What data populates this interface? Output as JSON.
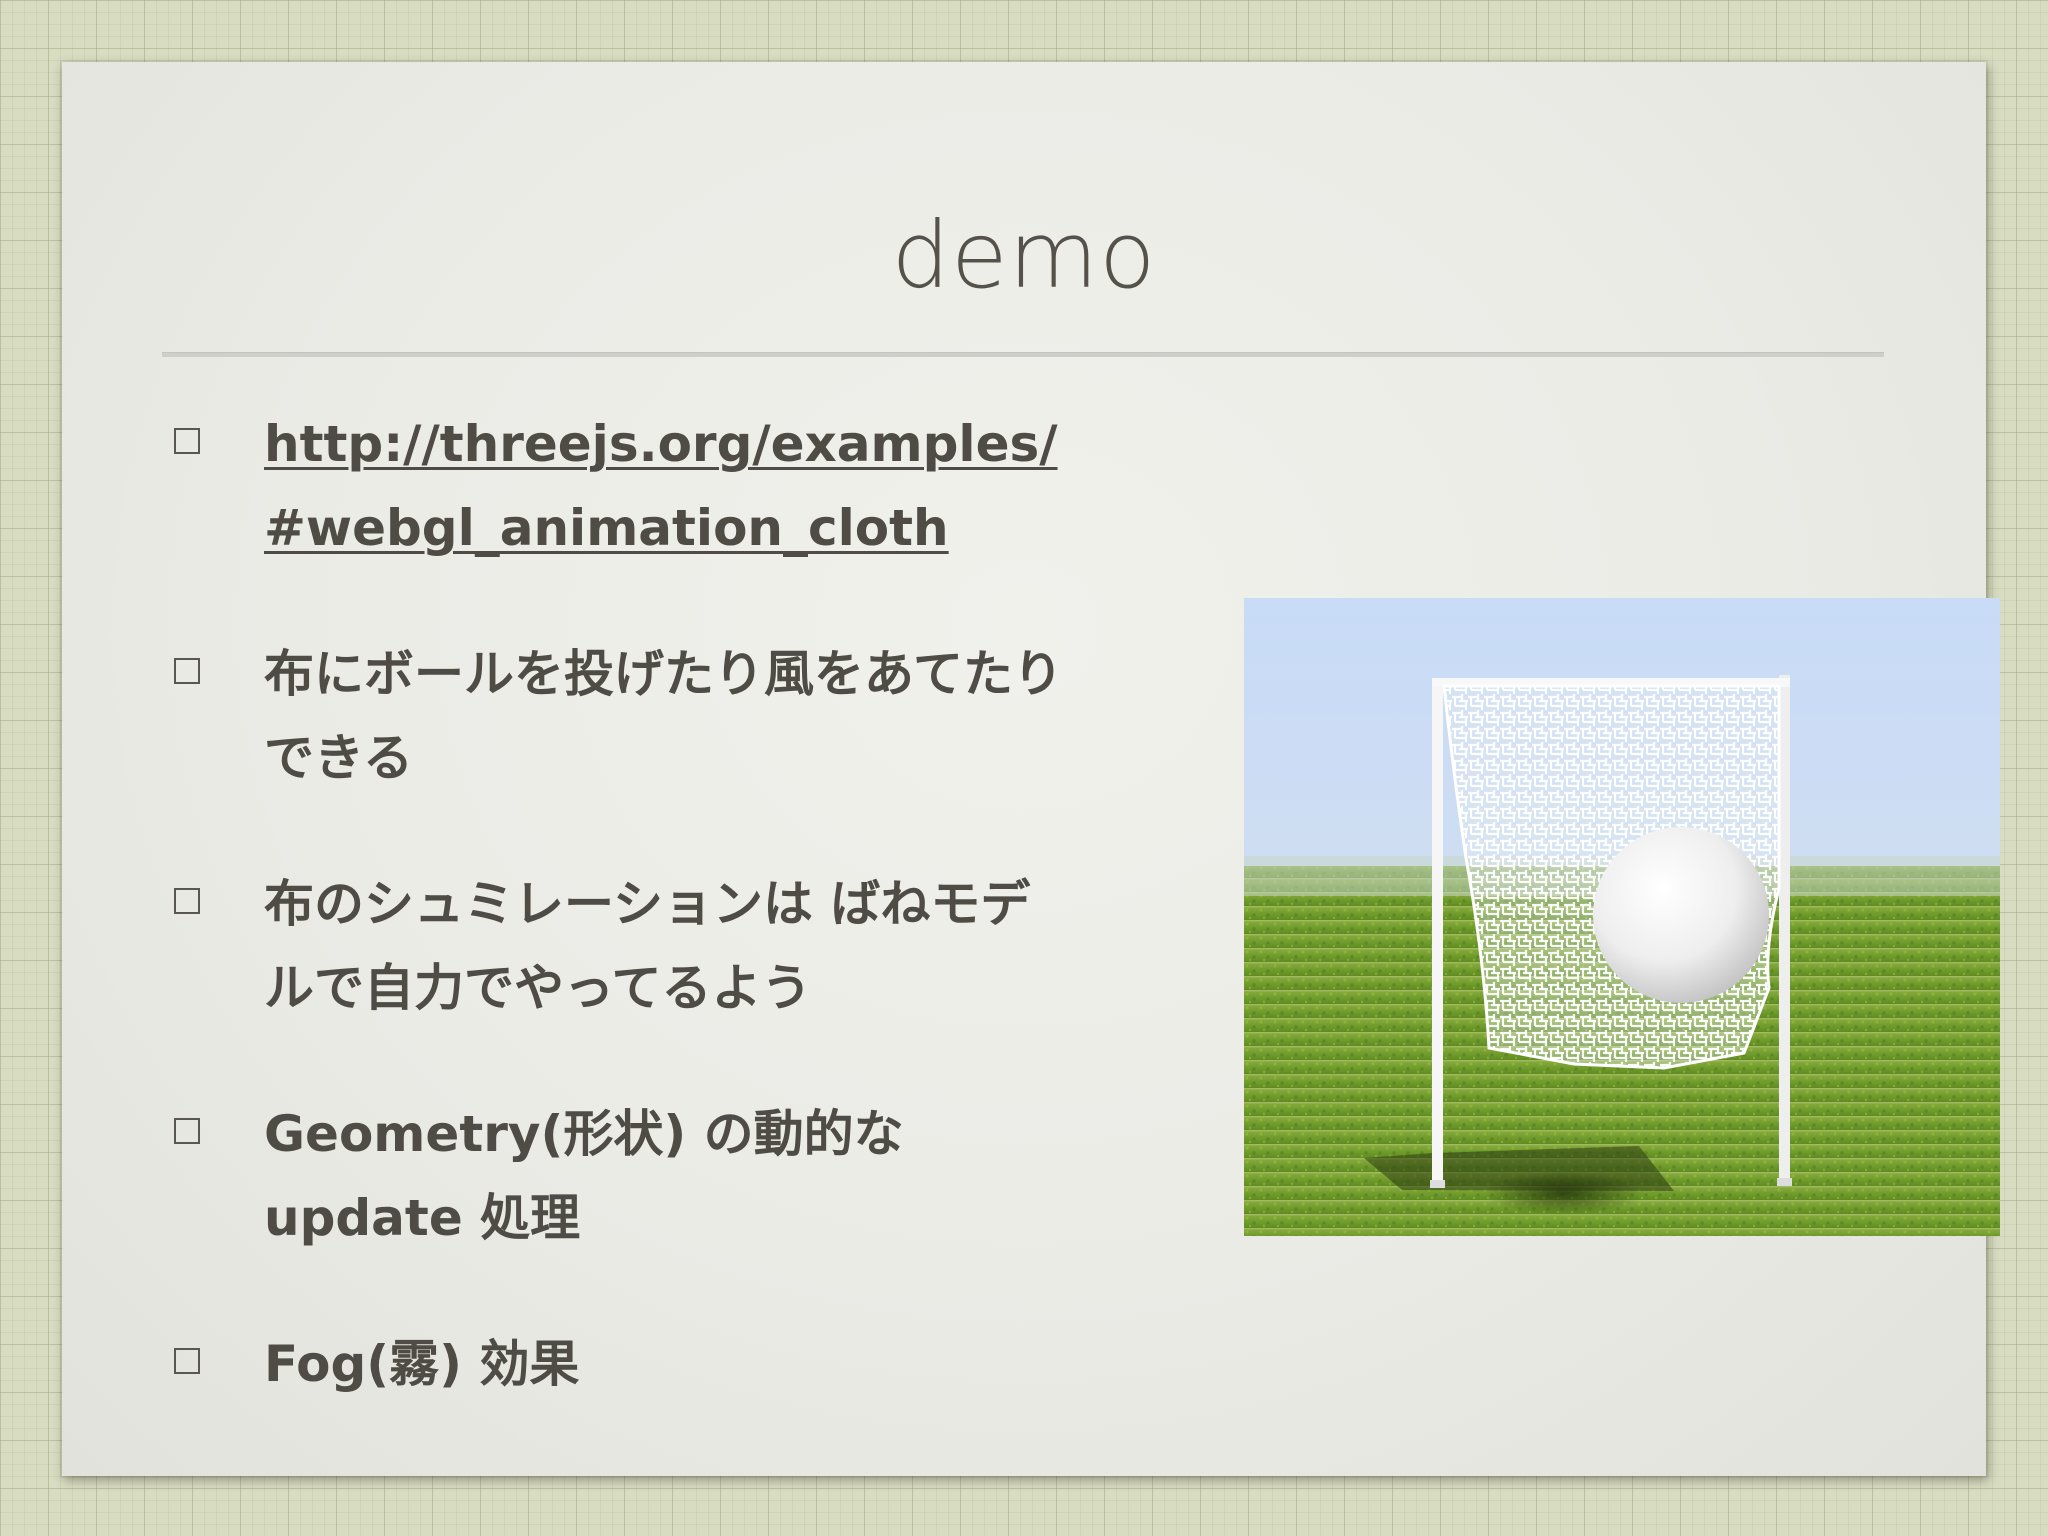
{
  "slide": {
    "title": "demo",
    "bullets": [
      {
        "line1": "http://threejs.org/examples/",
        "line2": "#webgl_animation_cloth",
        "is_link": true
      },
      {
        "line1": "布にボールを投げたり風をあてたり",
        "line2": "できる",
        "is_link": false
      },
      {
        "line1": "布のシュミレーションは ばねモデ",
        "line2": "ルで自力でやってるよう",
        "is_link": false
      },
      {
        "line1": "Geometry(形状) の動的な",
        "line2": "update 処理",
        "is_link": false
      },
      {
        "line1": "Fog(霧) 効果",
        "line2": "",
        "is_link": false
      }
    ]
  },
  "image": {
    "icon": "cloth-simulation-screenshot",
    "colors": {
      "sky": "#c9dcf6",
      "grass": "#6f9a2c",
      "cloth": "#ffffff",
      "ball": "#f2f2f2"
    }
  },
  "colors": {
    "text": "#4f4c45",
    "title": "#555249",
    "slide_bg": "#eeeeea",
    "page_bg": "#d8dcc0"
  }
}
